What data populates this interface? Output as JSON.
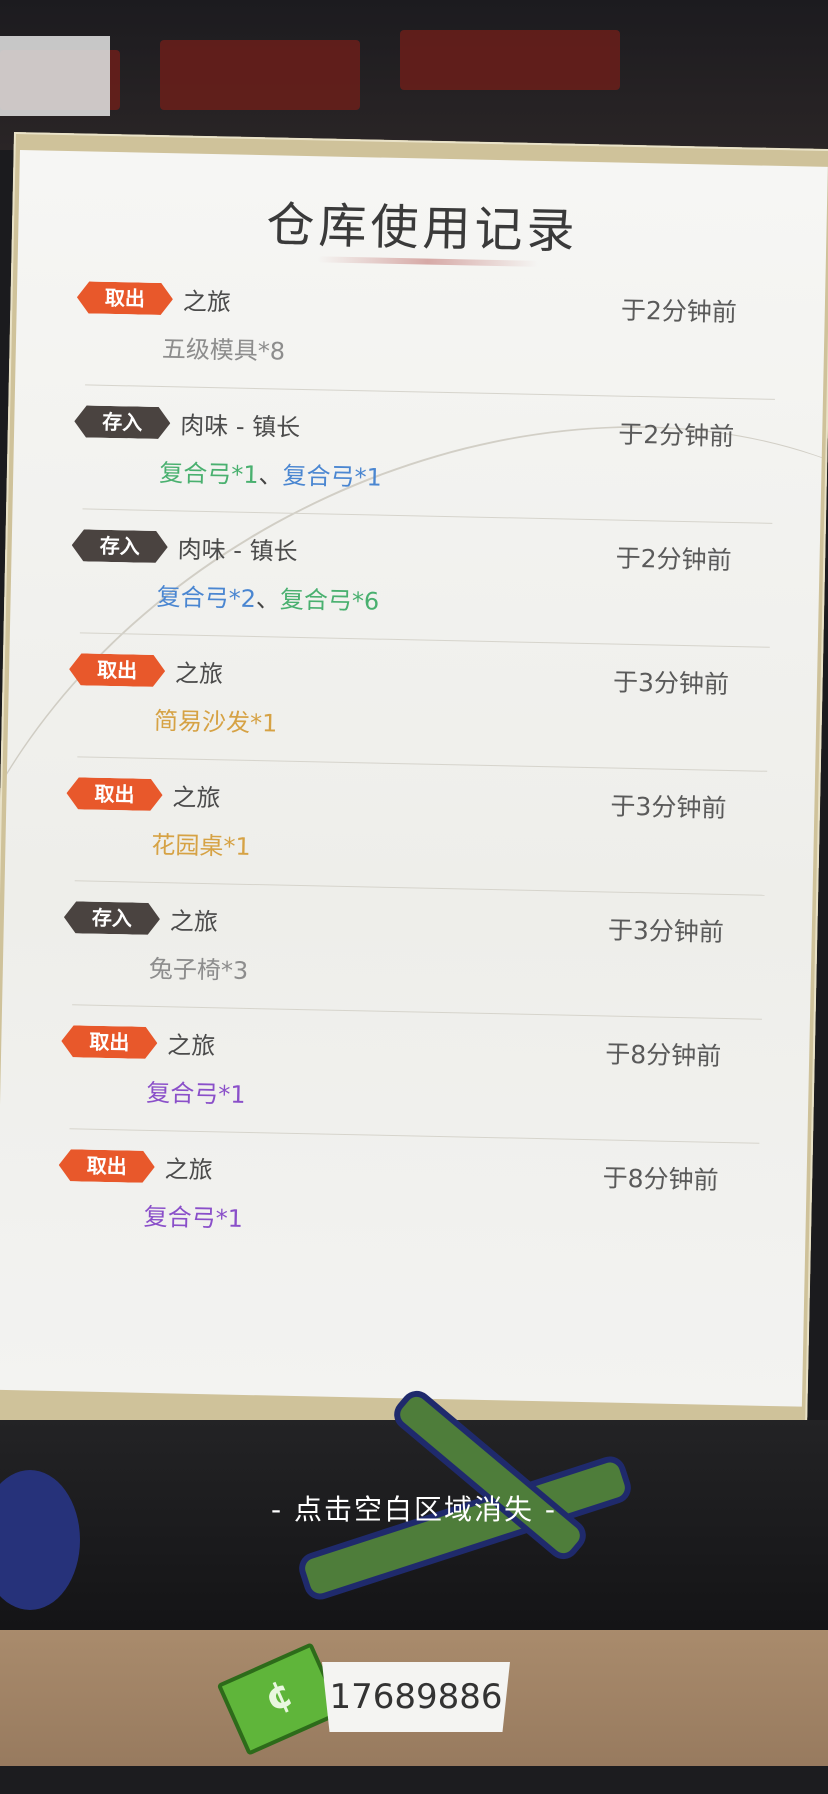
{
  "title": "仓库使用记录",
  "records": [
    {
      "type": "out",
      "tag": "取出",
      "who": "之旅",
      "when": "于2分钟前",
      "items": [
        {
          "text": "五级模具*8",
          "color": "gray"
        }
      ]
    },
    {
      "type": "in",
      "tag": "存入",
      "who": "肉味 - 镇长",
      "when": "于2分钟前",
      "items": [
        {
          "text": "复合弓*1",
          "color": "green"
        },
        {
          "text": "、",
          "color": "plain"
        },
        {
          "text": "复合弓*1",
          "color": "blue"
        }
      ]
    },
    {
      "type": "in",
      "tag": "存入",
      "who": "肉味 - 镇长",
      "when": "于2分钟前",
      "items": [
        {
          "text": "复合弓*2",
          "color": "blue"
        },
        {
          "text": "、",
          "color": "plain"
        },
        {
          "text": "复合弓*6",
          "color": "green"
        }
      ]
    },
    {
      "type": "out",
      "tag": "取出",
      "who": "之旅",
      "when": "于3分钟前",
      "items": [
        {
          "text": "简易沙发*1",
          "color": "gold"
        }
      ]
    },
    {
      "type": "out",
      "tag": "取出",
      "who": "之旅",
      "when": "于3分钟前",
      "items": [
        {
          "text": "花园桌*1",
          "color": "gold"
        }
      ]
    },
    {
      "type": "in",
      "tag": "存入",
      "who": "之旅",
      "when": "于3分钟前",
      "items": [
        {
          "text": "兔子椅*3",
          "color": "gray"
        }
      ]
    },
    {
      "type": "out",
      "tag": "取出",
      "who": "之旅",
      "when": "于8分钟前",
      "items": [
        {
          "text": "复合弓*1",
          "color": "purple"
        }
      ]
    },
    {
      "type": "out",
      "tag": "取出",
      "who": "之旅",
      "when": "于8分钟前",
      "items": [
        {
          "text": "复合弓*1",
          "color": "purple"
        }
      ]
    }
  ],
  "hint": "- 点击空白区域消失 -",
  "currency": {
    "icon": "cash-icon",
    "symbol": "¢",
    "amount": "17689886"
  },
  "colors": {
    "out_tag": "#e8582b",
    "in_tag": "#4a4340",
    "gray": "#8d8d8d",
    "green": "#49b06f",
    "blue": "#4a86d1",
    "gold": "#d6a244",
    "purple": "#8a4fc9"
  }
}
